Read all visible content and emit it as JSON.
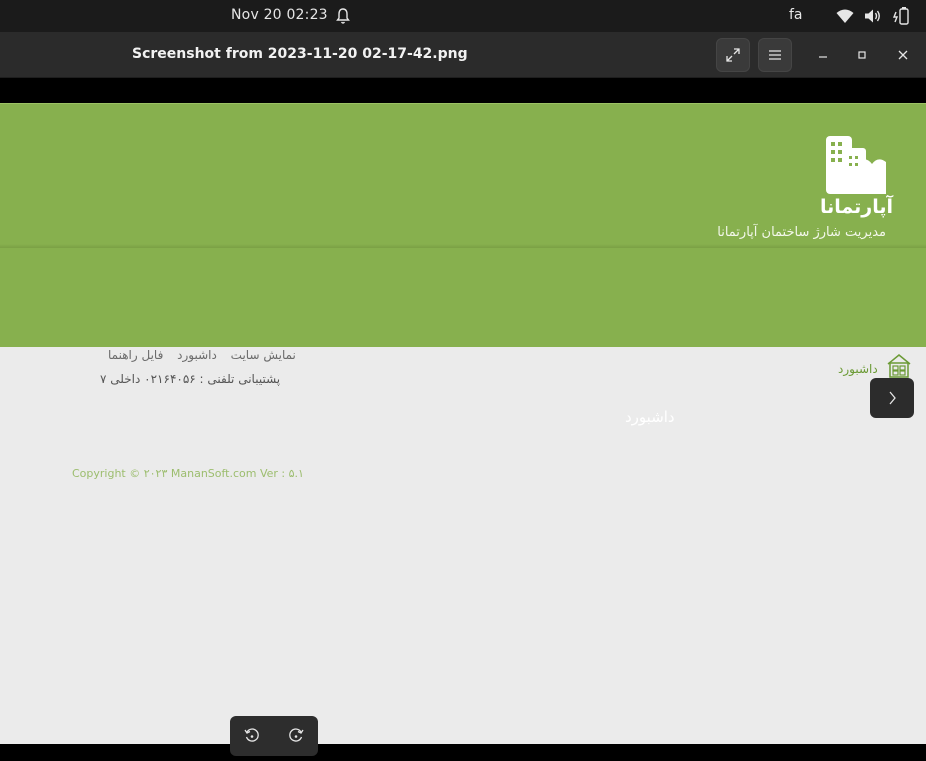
{
  "topbar": {
    "clock": "Nov 20  02:23",
    "input_lang": "fa",
    "icons": [
      "bell-icon",
      "wifi-icon",
      "volume-icon",
      "battery-icon"
    ]
  },
  "window": {
    "title": "Screenshot from 2023-11-20 02-17-42.png",
    "buttons": [
      "fullscreen-icon",
      "hamburger-menu-icon",
      "minimize-icon",
      "maximize-icon",
      "close-icon"
    ]
  },
  "image": {
    "brand": "آپارتمانا",
    "subtitle": "مدیریت شارژ ساختمان آپارتمانا",
    "page_heading": "داشبورد",
    "copyright": "Copyright © ۲۰۲۳ MananSoft.com Ver : ۵.۱",
    "links": [
      "نمایش سایت",
      "داشبورد",
      "فایل راهنما"
    ],
    "support": "پشتیبانی تلفنی : ۰۲۱۶۴۰۵۶ داخلی ۷",
    "breadcrumb": "داشبورد",
    "colors": {
      "header_green": "#87b04e",
      "breadcrumb_green": "#6b9a35",
      "page_bg": "#ebebeb"
    }
  },
  "osd": {
    "buttons": [
      "rotate-left-icon",
      "rotate-right-icon"
    ]
  }
}
